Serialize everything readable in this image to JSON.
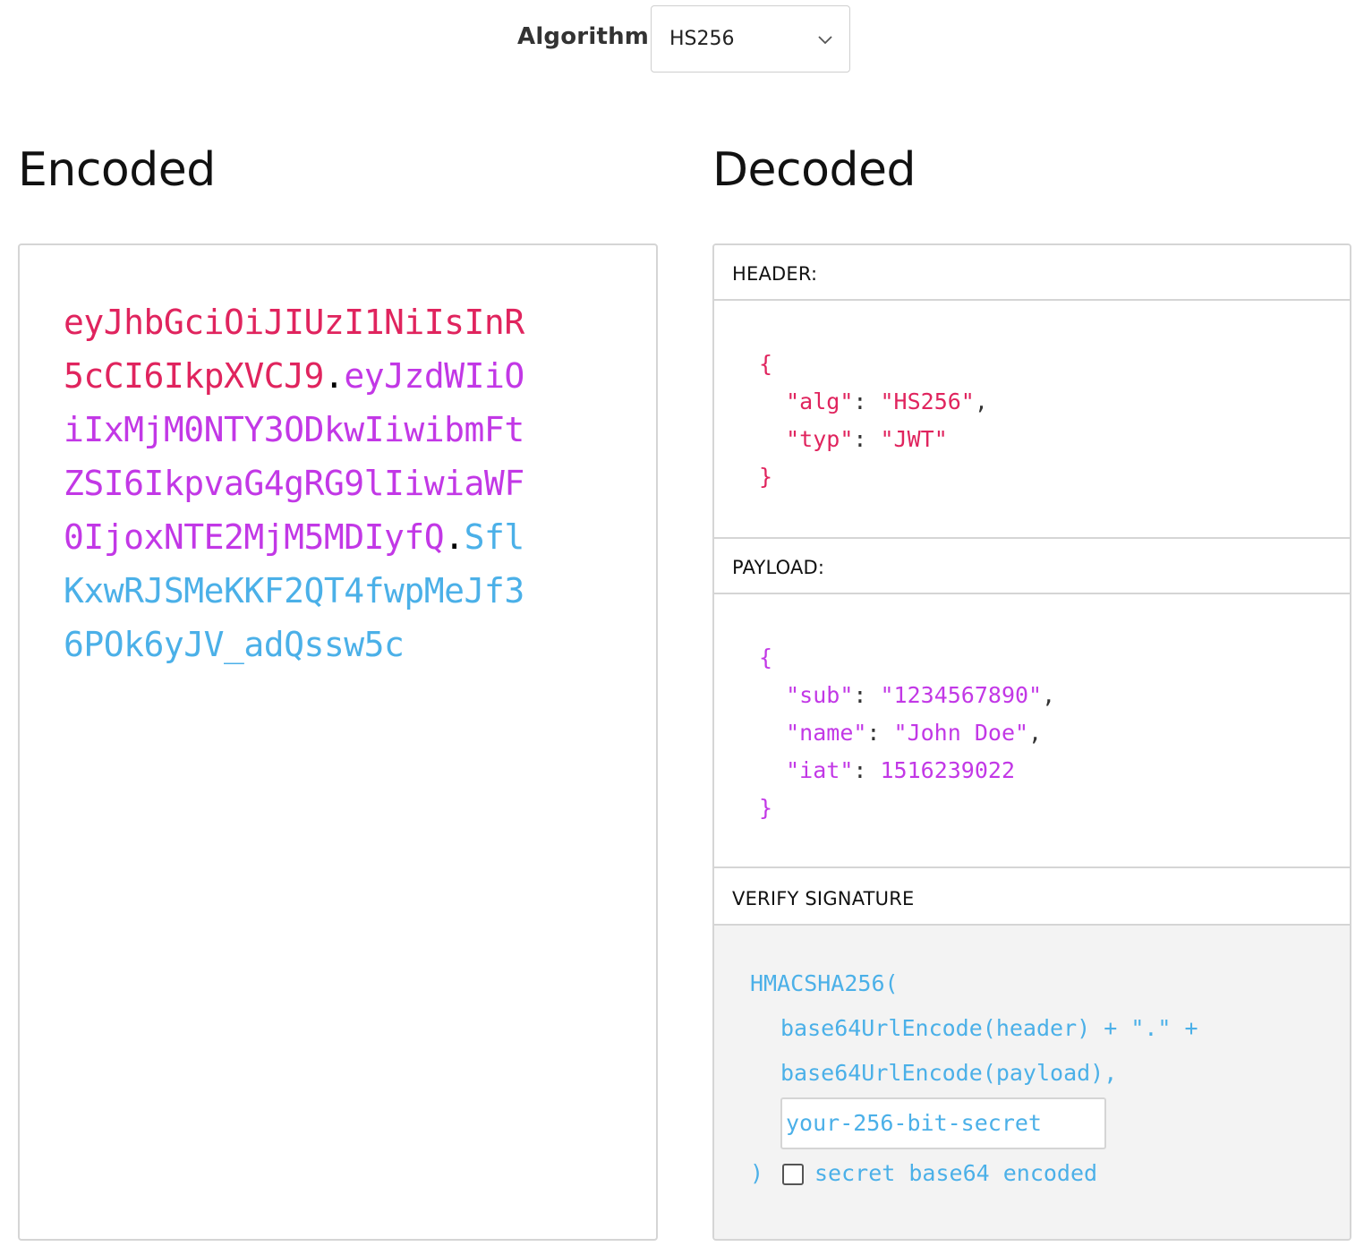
{
  "algorithm": {
    "label": "Algorithm",
    "selected": "HS256"
  },
  "encoded": {
    "title": "Encoded",
    "header_part": "eyJhbGciOiJIUzI1NiIsInR5cCI6IkpXVCJ9",
    "payload_part": "eyJzdWIiOiIxMjM0NTY3ODkwIiwibmFtZSI6IkpvaG4gRG9lIiwiaWF0IjoxNTE2MjM5MDIyfQ",
    "signature_part": "SflKxwRJSMeKKF2QT4fwpMeJf36POk6yJV_adQssw5c",
    "separator": "."
  },
  "decoded": {
    "title": "Decoded",
    "header": {
      "label": "HEADER:",
      "open": "{",
      "lines": [
        {
          "key": "\"alg\"",
          "value": "\"HS256\"",
          "trail": ","
        },
        {
          "key": "\"typ\"",
          "value": "\"JWT\"",
          "trail": ""
        }
      ],
      "close": "}"
    },
    "payload": {
      "label": "PAYLOAD:",
      "open": "{",
      "lines": [
        {
          "key": "\"sub\"",
          "value": "\"1234567890\"",
          "trail": ","
        },
        {
          "key": "\"name\"",
          "value": "\"John Doe\"",
          "trail": ","
        },
        {
          "key": "\"iat\"",
          "value": "1516239022",
          "trail": ""
        }
      ],
      "close": "}"
    },
    "verify": {
      "label": "VERIFY SIGNATURE",
      "fn": "HMACSHA256(",
      "line1": "base64UrlEncode(header) + \".\" +",
      "line2": "base64UrlEncode(payload),",
      "secret_value": "your-256-bit-secret",
      "close": ")",
      "checkbox_label": "secret base64 encoded",
      "checkbox_checked": false
    }
  },
  "colors": {
    "header": "#e0245e",
    "payload": "#c238e6",
    "signature": "#4bb0e8"
  }
}
